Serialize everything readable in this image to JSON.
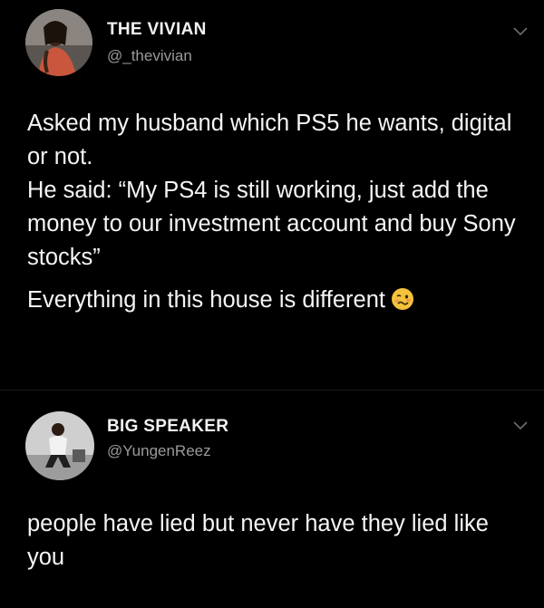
{
  "tweets": [
    {
      "display_name": "THE VIVIAN",
      "handle": "@_thevivian",
      "paragraphs": [
        "Asked my husband which PS5 he wants, digital or not.",
        "He said: “My PS4 is still working, just add the money to our investment account and buy Sony stocks”",
        "Everything in this house is different"
      ],
      "emoji": "woozy-face-icon"
    },
    {
      "display_name": "BIG SPEAKER",
      "handle": "@YungenReez",
      "paragraphs": [
        "people have lied but never have they lied like you"
      ]
    }
  ],
  "colors": {
    "background": "#000000",
    "text": "#f5f5f5",
    "handle": "#9a9a9a",
    "emoji": "#f4c23b"
  }
}
